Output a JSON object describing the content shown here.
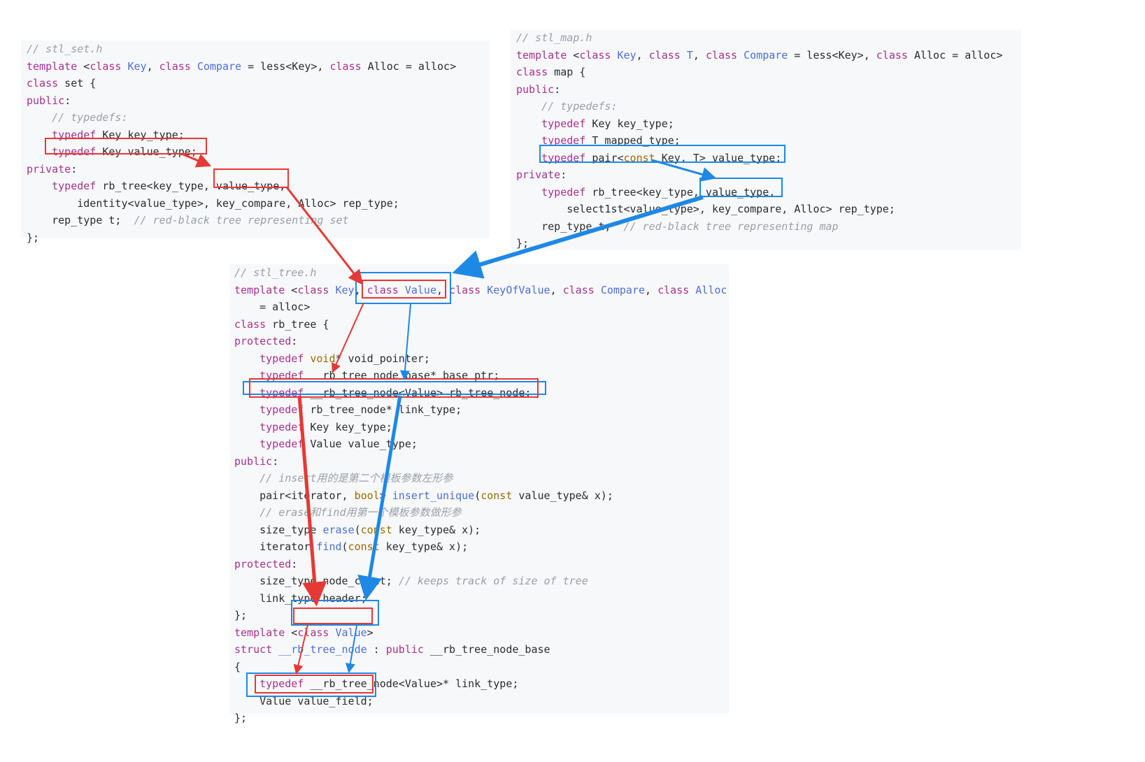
{
  "colors": {
    "keyword": "#a6328d",
    "type": "#4b6fd6",
    "comment": "#9aa0a6",
    "modifier": "#9b6a00",
    "text": "#2c2c2c",
    "panel_bg": "#f7f8fa",
    "set_path": "#e53935",
    "map_path": "#1e88e5"
  },
  "set_panel": {
    "lines": [
      [
        {
          "t": "// stl_set.h",
          "c": "cm"
        }
      ],
      [
        {
          "t": "template",
          "c": "kw"
        },
        {
          "t": " <"
        },
        {
          "t": "class",
          "c": "kw"
        },
        {
          "t": " "
        },
        {
          "t": "Key",
          "c": "ty"
        },
        {
          "t": ", "
        },
        {
          "t": "class",
          "c": "kw"
        },
        {
          "t": " "
        },
        {
          "t": "Compare",
          "c": "ty"
        },
        {
          "t": " = less<Key>, "
        },
        {
          "t": "class",
          "c": "kw"
        },
        {
          "t": " Alloc = alloc>"
        }
      ],
      [
        {
          "t": "class",
          "c": "kw"
        },
        {
          "t": " set {"
        }
      ],
      [
        {
          "t": "public",
          "c": "kw"
        },
        {
          "t": ":"
        }
      ],
      [
        {
          "t": "    "
        },
        {
          "t": "// typedefs:",
          "c": "cm"
        }
      ],
      [
        {
          "t": "    "
        },
        {
          "t": "typedef",
          "c": "kw"
        },
        {
          "t": " Key key_type;"
        }
      ],
      [
        {
          "t": "    "
        },
        {
          "t": "typedef",
          "c": "kw"
        },
        {
          "t": " Key value_type;"
        }
      ],
      [
        {
          "t": "private",
          "c": "kw"
        },
        {
          "t": ":"
        }
      ],
      [
        {
          "t": "    "
        },
        {
          "t": "typedef",
          "c": "kw"
        },
        {
          "t": " rb_tree<key_type, value_type,"
        }
      ],
      [
        {
          "t": "        identity<value_type>, key_compare, Alloc> rep_type;"
        }
      ],
      [
        {
          "t": "    rep_type t;  "
        },
        {
          "t": "// red-black tree representing set",
          "c": "cm"
        }
      ],
      [
        {
          "t": "};"
        }
      ]
    ]
  },
  "map_panel": {
    "lines": [
      [
        {
          "t": "// stl_map.h",
          "c": "cm"
        }
      ],
      [
        {
          "t": "template",
          "c": "kw"
        },
        {
          "t": " <"
        },
        {
          "t": "class",
          "c": "kw"
        },
        {
          "t": " "
        },
        {
          "t": "Key",
          "c": "ty"
        },
        {
          "t": ", "
        },
        {
          "t": "class",
          "c": "kw"
        },
        {
          "t": " "
        },
        {
          "t": "T",
          "c": "ty"
        },
        {
          "t": ", "
        },
        {
          "t": "class",
          "c": "kw"
        },
        {
          "t": " "
        },
        {
          "t": "Compare",
          "c": "ty"
        },
        {
          "t": " = less<Key>, "
        },
        {
          "t": "class",
          "c": "kw"
        },
        {
          "t": " Alloc = alloc>"
        }
      ],
      [
        {
          "t": "class",
          "c": "kw"
        },
        {
          "t": " map {"
        }
      ],
      [
        {
          "t": "public",
          "c": "kw"
        },
        {
          "t": ":"
        }
      ],
      [
        {
          "t": "    "
        },
        {
          "t": "// typedefs:",
          "c": "cm"
        }
      ],
      [
        {
          "t": "    "
        },
        {
          "t": "typedef",
          "c": "kw"
        },
        {
          "t": " Key key_type;"
        }
      ],
      [
        {
          "t": "    "
        },
        {
          "t": "typedef",
          "c": "kw"
        },
        {
          "t": " T mapped_type;"
        }
      ],
      [
        {
          "t": "    "
        },
        {
          "t": "typedef",
          "c": "kw"
        },
        {
          "t": " pair<"
        },
        {
          "t": "const",
          "c": "mod"
        },
        {
          "t": " Key, T> value_type;"
        }
      ],
      [
        {
          "t": "private",
          "c": "kw"
        },
        {
          "t": ":"
        }
      ],
      [
        {
          "t": "    "
        },
        {
          "t": "typedef",
          "c": "kw"
        },
        {
          "t": " rb_tree<key_type, value_type,"
        }
      ],
      [
        {
          "t": "        select1st<value_type>, key_compare, Alloc> rep_type;"
        }
      ],
      [
        {
          "t": "    rep_type t;  "
        },
        {
          "t": "// red-black tree representing map",
          "c": "cm"
        }
      ],
      [
        {
          "t": "};"
        }
      ]
    ]
  },
  "tree_panel": {
    "lines": [
      [
        {
          "t": "// stl_tree.h",
          "c": "cm"
        }
      ],
      [
        {
          "t": "template",
          "c": "kw"
        },
        {
          "t": " <"
        },
        {
          "t": "class",
          "c": "kw"
        },
        {
          "t": " "
        },
        {
          "t": "Key",
          "c": "ty"
        },
        {
          "t": ", "
        },
        {
          "t": "class",
          "c": "kw"
        },
        {
          "t": " "
        },
        {
          "t": "Value",
          "c": "ty"
        },
        {
          "t": ", "
        },
        {
          "t": "class",
          "c": "kw"
        },
        {
          "t": " "
        },
        {
          "t": "KeyOfValue",
          "c": "ty"
        },
        {
          "t": ", "
        },
        {
          "t": "class",
          "c": "kw"
        },
        {
          "t": " "
        },
        {
          "t": "Compare",
          "c": "ty"
        },
        {
          "t": ", "
        },
        {
          "t": "class",
          "c": "kw"
        },
        {
          "t": " "
        },
        {
          "t": "Alloc",
          "c": "ty"
        }
      ],
      [
        {
          "t": "    = alloc>"
        }
      ],
      [
        {
          "t": "class",
          "c": "kw"
        },
        {
          "t": " rb_tree {"
        }
      ],
      [
        {
          "t": "protected",
          "c": "kw"
        },
        {
          "t": ":"
        }
      ],
      [
        {
          "t": "    "
        },
        {
          "t": "typedef",
          "c": "kw"
        },
        {
          "t": " "
        },
        {
          "t": "void",
          "c": "mod"
        },
        {
          "t": "* void_pointer;"
        }
      ],
      [
        {
          "t": "    "
        },
        {
          "t": "typedef",
          "c": "kw"
        },
        {
          "t": " __rb_tree_node_base* base_ptr;"
        }
      ],
      [
        {
          "t": "    "
        },
        {
          "t": "typedef",
          "c": "kw"
        },
        {
          "t": " __rb_tree_node<Value> rb_tree_node;"
        }
      ],
      [
        {
          "t": "    "
        },
        {
          "t": "typedef",
          "c": "kw"
        },
        {
          "t": " rb_tree_node* link_type;"
        }
      ],
      [
        {
          "t": "    "
        },
        {
          "t": "typedef",
          "c": "kw"
        },
        {
          "t": " Key key_type;"
        }
      ],
      [
        {
          "t": "    "
        },
        {
          "t": "typedef",
          "c": "kw"
        },
        {
          "t": " Value value_type;"
        }
      ],
      [
        {
          "t": "public",
          "c": "kw"
        },
        {
          "t": ":"
        }
      ],
      [
        {
          "t": "    "
        },
        {
          "t": "// insert用的是第二个模板参数左形参",
          "c": "cm"
        }
      ],
      [
        {
          "t": "    pair<iterator, "
        },
        {
          "t": "bool",
          "c": "mod"
        },
        {
          "t": "> "
        },
        {
          "t": "insert_unique",
          "c": "fn"
        },
        {
          "t": "("
        },
        {
          "t": "const",
          "c": "mod"
        },
        {
          "t": " value_type& x);"
        }
      ],
      [
        {
          "t": "    "
        },
        {
          "t": "// erase和find用第一个模板参数做形参",
          "c": "cm"
        }
      ],
      [
        {
          "t": "    size_type "
        },
        {
          "t": "erase",
          "c": "fn"
        },
        {
          "t": "("
        },
        {
          "t": "const",
          "c": "mod"
        },
        {
          "t": " key_type& x);"
        }
      ],
      [
        {
          "t": "    iterator "
        },
        {
          "t": "find",
          "c": "fn"
        },
        {
          "t": "("
        },
        {
          "t": "const",
          "c": "mod"
        },
        {
          "t": " key_type& x);"
        }
      ],
      [
        {
          "t": "protected",
          "c": "kw"
        },
        {
          "t": ":"
        }
      ],
      [
        {
          "t": "    size_type node_count; "
        },
        {
          "t": "// keeps track of size of tree",
          "c": "cm"
        }
      ],
      [
        {
          "t": "    link_type header;"
        }
      ],
      [
        {
          "t": "};"
        }
      ],
      [
        {
          "t": "template",
          "c": "kw"
        },
        {
          "t": " <"
        },
        {
          "t": "class",
          "c": "kw"
        },
        {
          "t": " "
        },
        {
          "t": "Value",
          "c": "ty"
        },
        {
          "t": ">"
        }
      ],
      [
        {
          "t": "struct",
          "c": "kw"
        },
        {
          "t": " "
        },
        {
          "t": "__rb_tree_node",
          "c": "ty"
        },
        {
          "t": " : "
        },
        {
          "t": "public",
          "c": "kw"
        },
        {
          "t": " __rb_tree_node_base"
        }
      ],
      [
        {
          "t": "{"
        }
      ],
      [
        {
          "t": "    "
        },
        {
          "t": "typedef",
          "c": "kw"
        },
        {
          "t": " __rb_tree_node<Value>* link_type;"
        }
      ],
      [
        {
          "t": "    Value value_field;"
        }
      ],
      [
        {
          "t": "};"
        }
      ]
    ]
  }
}
